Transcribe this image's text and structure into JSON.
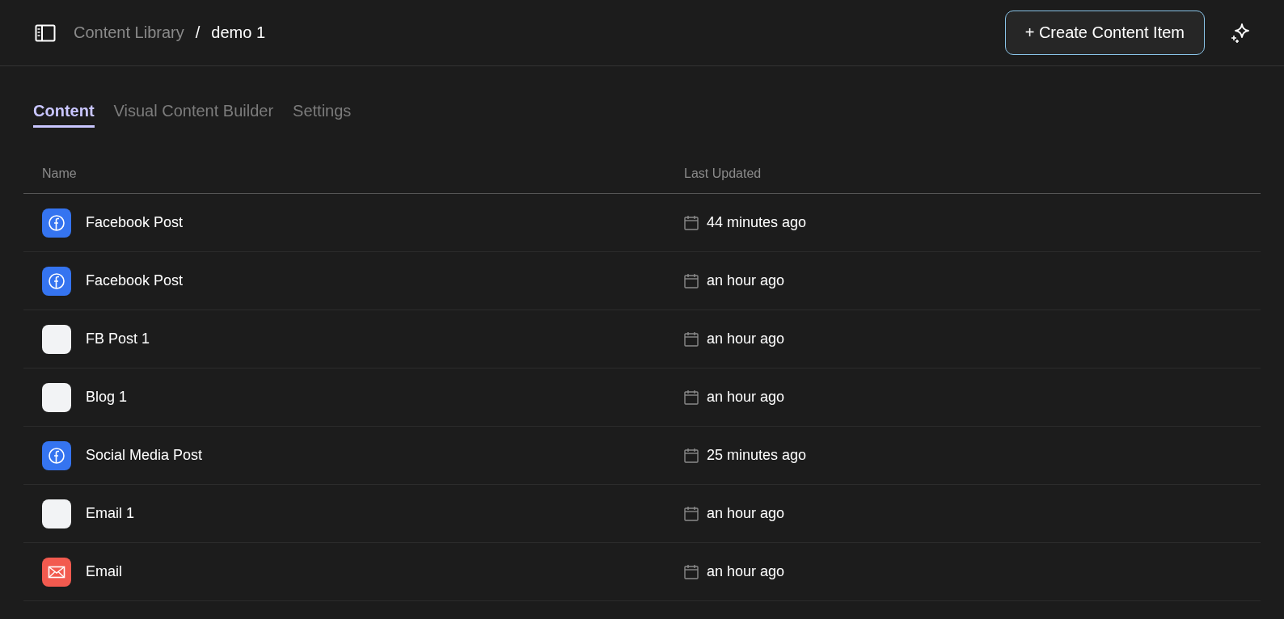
{
  "breadcrumb": {
    "parent": "Content Library",
    "separator": "/",
    "current": "demo 1"
  },
  "create_button": "+ Create Content Item",
  "tabs": [
    {
      "label": "Content",
      "selected": true
    },
    {
      "label": "Visual Content Builder",
      "selected": false
    },
    {
      "label": "Settings",
      "selected": false
    }
  ],
  "table": {
    "columns": [
      "Name",
      "Last Updated"
    ],
    "rows": [
      {
        "kind": "facebook",
        "name": "Facebook Post",
        "updated": "44 minutes ago"
      },
      {
        "kind": "facebook",
        "name": "Facebook Post",
        "updated": "an hour ago"
      },
      {
        "kind": "blank",
        "name": "FB Post 1",
        "updated": "an hour ago"
      },
      {
        "kind": "blank",
        "name": "Blog 1",
        "updated": "an hour ago"
      },
      {
        "kind": "facebook",
        "name": "Social Media Post",
        "updated": "25 minutes ago"
      },
      {
        "kind": "blank",
        "name": "Email 1",
        "updated": "an hour ago"
      },
      {
        "kind": "email",
        "name": "Email",
        "updated": "an hour ago"
      }
    ]
  }
}
